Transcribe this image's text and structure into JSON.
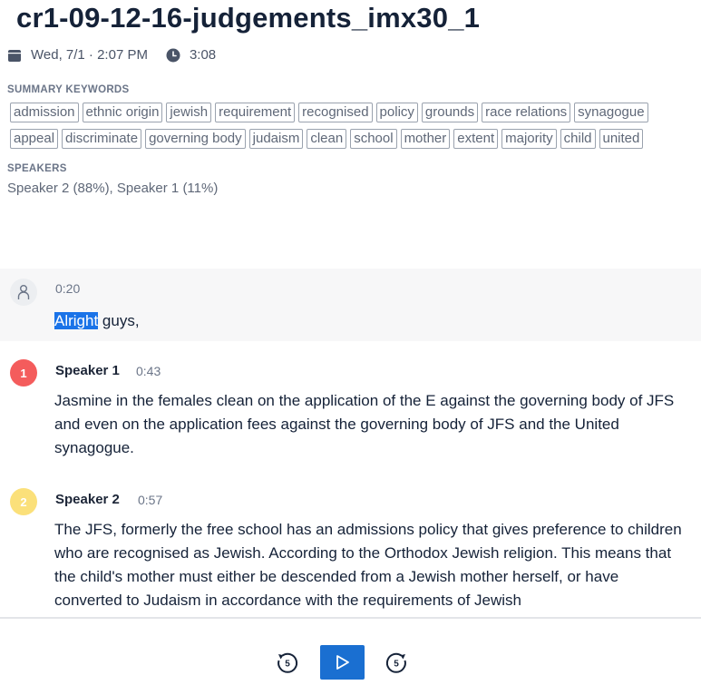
{
  "header": {
    "title": "cr1-09-12-16-judgements_imx30_1",
    "date": "Wed, 7/1 · 2:07 PM",
    "duration": "3:08"
  },
  "keywords": {
    "label": "SUMMARY KEYWORDS",
    "row1": [
      "admission",
      "ethnic origin",
      "jewish",
      "requirement",
      "recognised",
      "policy",
      "grounds",
      "race relations",
      "synagogue"
    ],
    "row2": [
      "appeal",
      "discriminate",
      "governing body",
      "judaism",
      "clean",
      "school",
      "mother",
      "extent",
      "majority",
      "child",
      "united"
    ]
  },
  "speakers": {
    "label": "SPEAKERS",
    "summary": "Speaker 2 (88%), Speaker 1 (11%)"
  },
  "transcript": [
    {
      "avatar": "",
      "speaker": "",
      "time": "0:20",
      "selected": "Alright",
      "text": " guys,"
    },
    {
      "avatar": "1",
      "speaker": "Speaker 1",
      "time": "0:43",
      "text": "Jasmine in the females clean on the application of the E against the governing body of JFS and even on the application fees against the governing body of JFS and the United synagogue."
    },
    {
      "avatar": "2",
      "speaker": "Speaker 2",
      "time": "0:57",
      "text": "The JFS, formerly the free school has an admissions policy that gives preference to children who are recognised as Jewish. According to the Orthodox Jewish religion. This means that the child's mother must either be descended from a Jewish mother herself, or have converted to Judaism in accordance with the requirements of Jewish"
    }
  ],
  "player": {
    "rewind_label": "5",
    "forward_label": "5"
  },
  "colors": {
    "speaker1": "#f45c5c",
    "speaker2": "#fbe07a",
    "accent": "#1a6fd1"
  }
}
